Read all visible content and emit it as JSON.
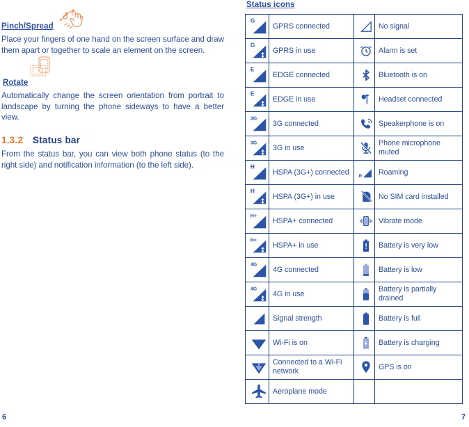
{
  "colors": {
    "blue_text": "#2c4f9e",
    "dark_blue": "#1f4287",
    "orange": "#e8772e",
    "icon_blue": "#2d55a5",
    "icon_light": "#9aa8d8"
  },
  "left_page": {
    "pinch": {
      "term": "Pinch/Spread",
      "icon": "pinch-spread-hand-icon",
      "body": "Place your fingers of one hand on the screen surface and draw them apart or together to scale an element on the screen."
    },
    "rotate": {
      "term": "Rotate",
      "icon": "rotate-phone-icon",
      "body": "Automatically change the screen orientation from portrait to landscape by turning the phone sideways to have a better view."
    },
    "section": {
      "number": "1.3.2",
      "title": "Status bar",
      "body": "From the status bar, you can view both phone status (to the right side) and notification information (to the left side)."
    },
    "page_number": "6"
  },
  "right_page": {
    "table_title": "Status icons",
    "page_number": "7",
    "rows": [
      {
        "left_icon": "gprs-connected-icon",
        "left_label": "GPRS connected",
        "right_icon": "no-signal-icon",
        "right_label": "No signal"
      },
      {
        "left_icon": "gprs-in-use-icon",
        "left_label": "GPRS in use",
        "right_icon": "alarm-clock-icon",
        "right_label": "Alarm is set"
      },
      {
        "left_icon": "edge-connected-icon",
        "left_label": "EDGE connected",
        "right_icon": "bluetooth-icon",
        "right_label": "Bluetooth is on"
      },
      {
        "left_icon": "edge-in-use-icon",
        "left_label": "EDGE in use",
        "right_icon": "headset-icon",
        "right_label": "Headset connected"
      },
      {
        "left_icon": "3g-connected-icon",
        "left_label": "3G connected",
        "right_icon": "speakerphone-icon",
        "right_label": "Speakerphone is on"
      },
      {
        "left_icon": "3g-in-use-icon",
        "left_label": "3G in use",
        "right_icon": "microphone-muted-icon",
        "right_label": "Phone microphone muted"
      },
      {
        "left_icon": "hspa-connected-icon",
        "left_label": "HSPA (3G+) connected",
        "right_icon": "roaming-icon",
        "right_label": "Roaming"
      },
      {
        "left_icon": "hspa-in-use-icon",
        "left_label": "HSPA (3G+) in use",
        "right_icon": "no-sim-card-icon",
        "right_label": "No SIM card installed"
      },
      {
        "left_icon": "hspaplus-connected-icon",
        "left_label": "HSPA+ connected",
        "right_icon": "vibrate-icon",
        "right_label": "Vibrate mode"
      },
      {
        "left_icon": "hspaplus-in-use-icon",
        "left_label": "HSPA+ in use",
        "right_icon": "battery-very-low-icon",
        "right_label": "Battery is very low"
      },
      {
        "left_icon": "4g-connected-icon",
        "left_label": "4G connected",
        "right_icon": "battery-low-icon",
        "right_label": "Battery is low"
      },
      {
        "left_icon": "4g-in-use-icon",
        "left_label": "4G in use",
        "right_icon": "battery-partial-icon",
        "right_label": "Battery is partially drained"
      },
      {
        "left_icon": "signal-strength-icon",
        "left_label": "Signal strength",
        "right_icon": "battery-full-icon",
        "right_label": "Battery is full"
      },
      {
        "left_icon": "wifi-on-icon",
        "left_label": "Wi-Fi is on",
        "right_icon": "battery-charging-icon",
        "right_label": "Battery is charging"
      },
      {
        "left_icon": "wifi-connected-icon",
        "left_label": "Connected to a Wi-Fi network",
        "right_icon": "gps-icon",
        "right_label": "GPS is on"
      },
      {
        "left_icon": "aeroplane-mode-icon",
        "left_label": "Aeroplane mode",
        "right_icon": "",
        "right_label": ""
      }
    ]
  }
}
